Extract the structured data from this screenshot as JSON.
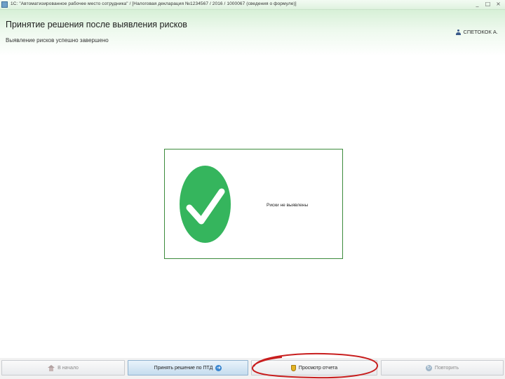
{
  "window": {
    "title": "1С: \"Автоматизированное рабочее место сотрудника\" / [Налоговая декларация №1234567 / 2016 / 1000067 (сведения о формуле)]",
    "controls": [
      "_",
      "□",
      "×"
    ]
  },
  "header": {
    "title": "Принятие решения после выявления рисков",
    "subtitle": "Выявление рисков успешно завершено",
    "user": "СПЕТОКОК А."
  },
  "result": {
    "message": "Риски не выявлены",
    "status_color": "#35b55d"
  },
  "toolbar": {
    "home_label": "В начало",
    "decide_label": "Принять решение по ПТД",
    "report_label": "Просмотр отчета",
    "repeat_label": "Повторить"
  },
  "icons": {
    "home": "home-icon",
    "decide": "arrow-right-icon",
    "report": "shield-icon",
    "repeat": "repeat-icon"
  },
  "colors": {
    "accent_green": "#35b55d",
    "highlight_red": "#c81e1e",
    "active_button": "#c5dcee"
  }
}
